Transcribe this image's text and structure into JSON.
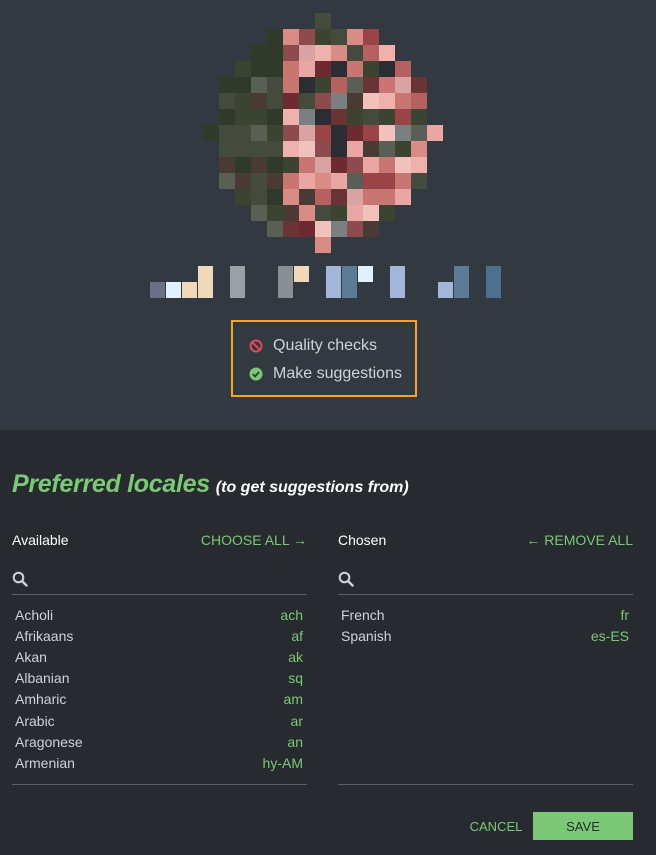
{
  "profile": {
    "permissions": [
      {
        "label": "Quality checks",
        "state": "denied",
        "icon": "ban-icon",
        "color": "#e5475a"
      },
      {
        "label": "Make suggestions",
        "state": "granted",
        "icon": "check-circle-icon",
        "color": "#7bc876"
      }
    ]
  },
  "locales": {
    "title": "Preferred locales",
    "subtitle": "(to get suggestions from)",
    "available": {
      "label": "Available",
      "action": "CHOOSE ALL →",
      "search_placeholder": "",
      "items": [
        {
          "name": "Acholi",
          "code": "ach"
        },
        {
          "name": "Afrikaans",
          "code": "af"
        },
        {
          "name": "Akan",
          "code": "ak"
        },
        {
          "name": "Albanian",
          "code": "sq"
        },
        {
          "name": "Amharic",
          "code": "am"
        },
        {
          "name": "Arabic",
          "code": "ar"
        },
        {
          "name": "Aragonese",
          "code": "an"
        },
        {
          "name": "Armenian",
          "code": "hy-AM"
        }
      ]
    },
    "chosen": {
      "label": "Chosen",
      "action": "← REMOVE ALL",
      "search_placeholder": "",
      "items": [
        {
          "name": "French",
          "code": "fr"
        },
        {
          "name": "Spanish",
          "code": "es-ES"
        }
      ]
    }
  },
  "footer": {
    "cancel_label": "CANCEL",
    "save_label": "SAVE"
  },
  "colors": {
    "accent": "#7bc876",
    "highlight_border": "#f5a623",
    "panel_top": "#333941",
    "panel_bottom": "#272a2f"
  }
}
